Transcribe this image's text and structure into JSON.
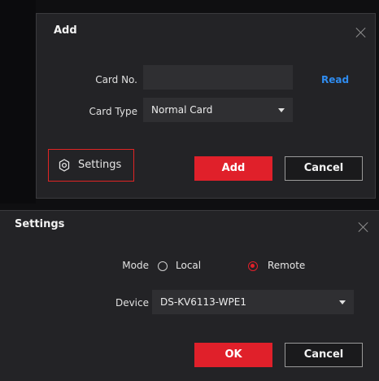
{
  "add_dialog": {
    "title": "Add",
    "card_no_label": "Card No.",
    "card_no_value": "",
    "read_link": "Read",
    "card_type_label": "Card Type",
    "card_type_value": "Normal Card",
    "settings_label": "Settings",
    "add_button": "Add",
    "cancel_button": "Cancel"
  },
  "settings_dialog": {
    "title": "Settings",
    "mode_label": "Mode",
    "mode_options": [
      "Local",
      "Remote"
    ],
    "mode_selected": "Remote",
    "device_label": "Device",
    "device_value": "DS-KV6113-WPE1",
    "ok_button": "OK",
    "cancel_button": "Cancel"
  },
  "icons": {
    "close": "close-icon",
    "gear": "gear-icon",
    "dropdown": "chevron-down-icon"
  },
  "colors": {
    "accent_red": "#e0202a",
    "link_blue": "#2f8cf0",
    "dialog_bg": "#232326",
    "input_bg": "#2f2f32"
  }
}
